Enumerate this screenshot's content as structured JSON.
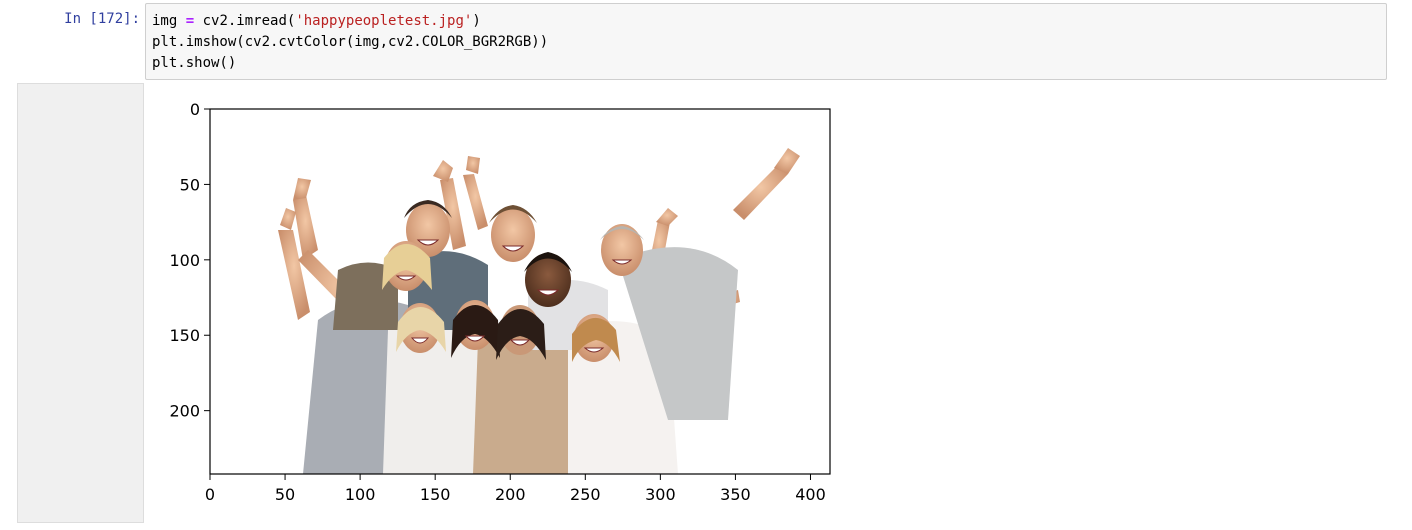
{
  "cell": {
    "prompt": "In [172]:",
    "code_lines": [
      [
        {
          "t": "img ",
          "c": ""
        },
        {
          "t": "=",
          "c": "op"
        },
        {
          "t": " cv2.imread(",
          "c": ""
        },
        {
          "t": "'happypeopletest.jpg'",
          "c": "str"
        },
        {
          "t": ")",
          "c": ""
        }
      ],
      [
        {
          "t": "plt.imshow(cv2.cvtColor(img,cv2.COLOR_BGR2RGB))",
          "c": ""
        }
      ],
      [
        {
          "t": "plt.show()",
          "c": ""
        }
      ]
    ]
  },
  "chart_data": {
    "type": "image",
    "title": "",
    "xlabel": "",
    "ylabel": "",
    "xlim": [
      0,
      413
    ],
    "ylim": [
      242,
      0
    ],
    "x_ticks": [
      0,
      50,
      100,
      150,
      200,
      250,
      300,
      350,
      400
    ],
    "y_ticks": [
      0,
      50,
      100,
      150,
      200
    ],
    "image_description_icon": "photo-icon",
    "colors": {
      "axis": "#000000",
      "background": "#ffffff",
      "input_bg": "#f7f7f7",
      "prompt": "#303f9f"
    }
  }
}
